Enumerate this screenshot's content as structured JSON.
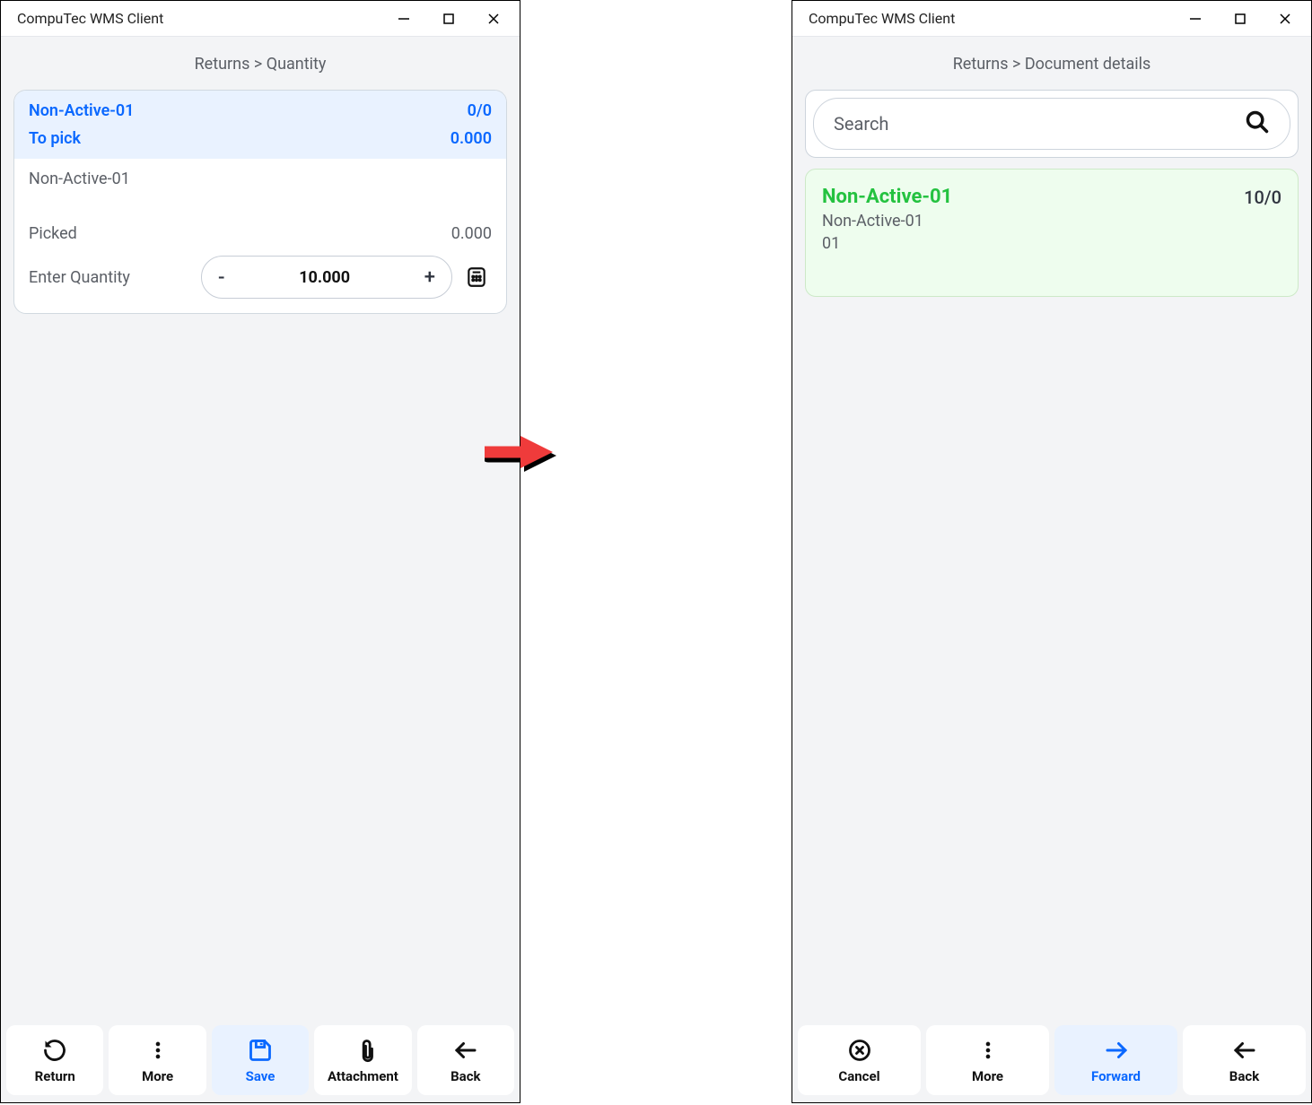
{
  "window": {
    "title": "CompuTec WMS Client"
  },
  "left": {
    "breadcrumb": "Returns > Quantity",
    "card": {
      "item_code": "Non-Active-01",
      "ratio": "0/0",
      "to_pick_label": "To pick",
      "to_pick_value": "0.000",
      "item_name": "Non-Active-01",
      "picked_label": "Picked",
      "picked_value": "0.000",
      "enter_qty_label": "Enter Quantity",
      "qty_value": "10.000"
    },
    "nav": {
      "return": "Return",
      "more": "More",
      "save": "Save",
      "attachment": "Attachment",
      "back": "Back"
    }
  },
  "right": {
    "breadcrumb": "Returns > Document details",
    "search_placeholder": "Search",
    "item": {
      "code": "Non-Active-01",
      "ratio": "10/0",
      "name": "Non-Active-01",
      "bin": "01"
    },
    "nav": {
      "cancel": "Cancel",
      "more": "More",
      "forward": "Forward",
      "back": "Back"
    }
  }
}
